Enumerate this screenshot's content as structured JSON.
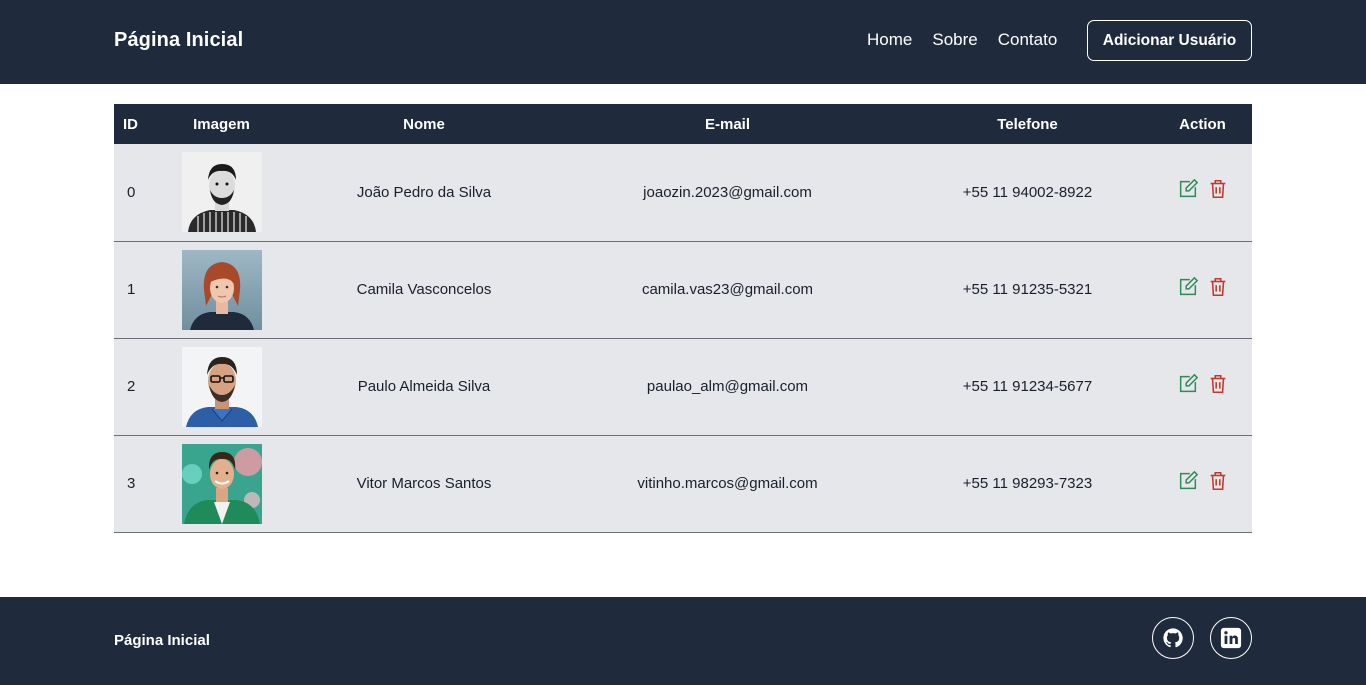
{
  "header": {
    "brand": "Página Inicial",
    "nav": [
      "Home",
      "Sobre",
      "Contato"
    ],
    "add_button": "Adicionar Usuário"
  },
  "table": {
    "columns": [
      "ID",
      "Imagem",
      "Nome",
      "E-mail",
      "Telefone",
      "Action"
    ],
    "rows": [
      {
        "id": "0",
        "name": "João Pedro da Silva",
        "email": "joaozin.2023@gmail.com",
        "phone": "+55 11 94002-8922"
      },
      {
        "id": "1",
        "name": "Camila Vasconcelos",
        "email": "camila.vas23@gmail.com",
        "phone": "+55 11 91235-5321"
      },
      {
        "id": "2",
        "name": "Paulo Almeida Silva",
        "email": "paulao_alm@gmail.com",
        "phone": "+55 11 91234-5677"
      },
      {
        "id": "3",
        "name": "Vitor Marcos Santos",
        "email": "vitinho.marcos@gmail.com",
        "phone": "+55 11 98293-7323"
      }
    ]
  },
  "footer": {
    "brand": "Página Inicial",
    "social": [
      "github-icon",
      "linkedin-icon"
    ]
  },
  "colors": {
    "navbar": "#1f2a3c",
    "row_bg": "#e5e7eb",
    "edit": "#2e8b57",
    "delete": "#c0392b"
  }
}
